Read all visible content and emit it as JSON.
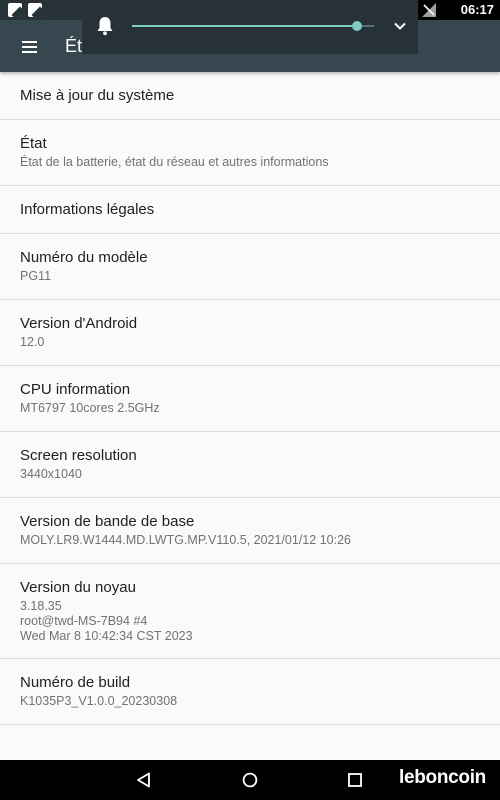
{
  "status_bar": {
    "time": "06:17"
  },
  "toolbar": {
    "title": "État"
  },
  "volume": {
    "level": 0.93
  },
  "settings": {
    "system_update": {
      "title": "Mise à jour du système"
    },
    "status": {
      "title": "État",
      "summary": "État de la batterie, état du réseau et autres informations"
    },
    "legal_info": {
      "title": "Informations légales"
    },
    "model_number": {
      "title": "Numéro du modèle",
      "value": "PG11"
    },
    "android_version": {
      "title": "Version d'Android",
      "value": "12.0"
    },
    "cpu_info": {
      "title": "CPU information",
      "value": "MT6797 10cores 2.5GHz"
    },
    "screen_resolution": {
      "title": "Screen resolution",
      "value": "3440x1040"
    },
    "baseband_version": {
      "title": "Version de bande de base",
      "value": "MOLY.LR9.W1444.MD.LWTG.MP.V110.5, 2021/01/12 10:26"
    },
    "kernel_version": {
      "title": "Version du noyau",
      "lines": [
        "3.18.35",
        "root@twd-MS-7B94 #4",
        "Wed Mar 8 10:42:34 CST 2023"
      ]
    },
    "build_number": {
      "title": "Numéro de build",
      "value": "K1035P3_V1.0.0_20230308"
    }
  },
  "watermark": "leboncoin",
  "colors": {
    "toolbar": "#37474f",
    "status_bar": "#263238",
    "accent": "#80cbc4",
    "background": "#fafafa"
  }
}
